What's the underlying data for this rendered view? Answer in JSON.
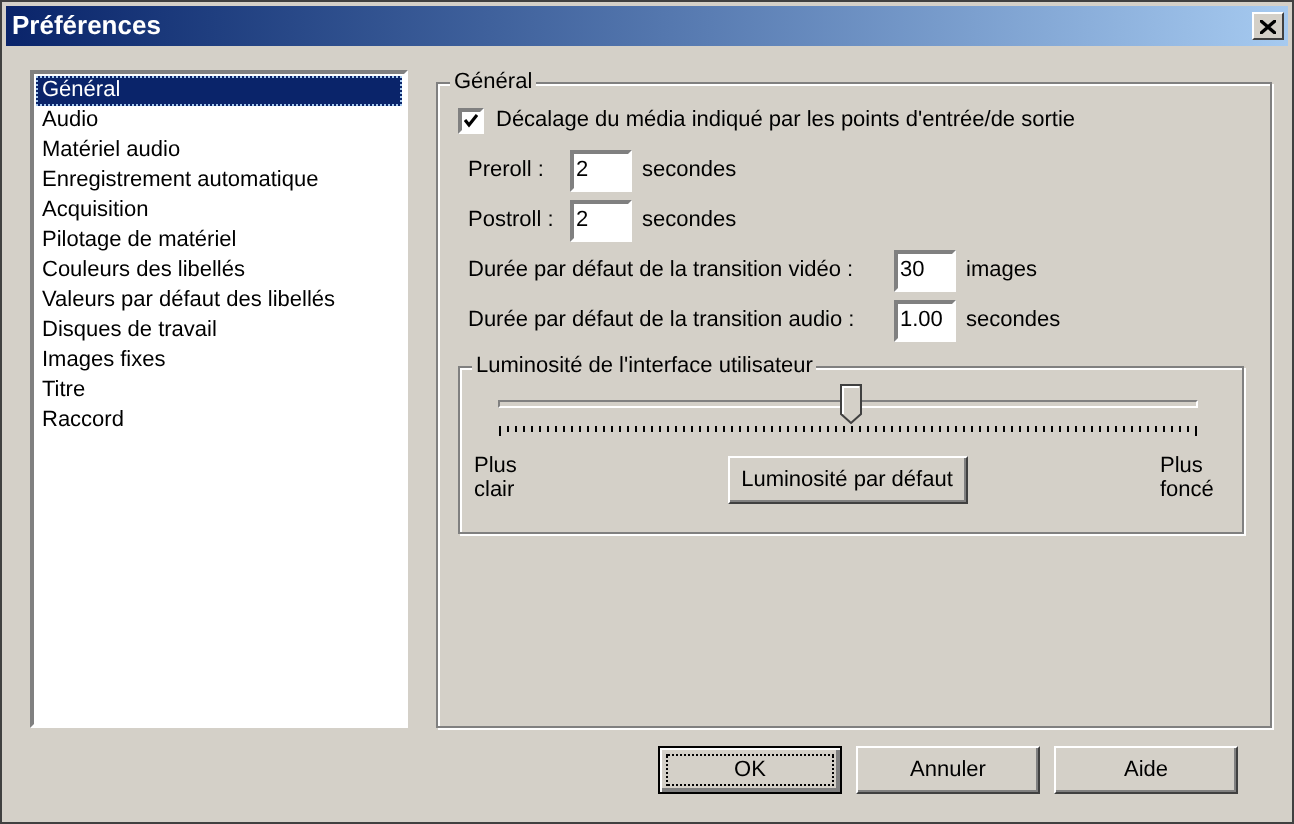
{
  "window": {
    "title": "Préférences"
  },
  "categories": [
    {
      "label": "Général",
      "selected": true
    },
    {
      "label": "Audio",
      "selected": false
    },
    {
      "label": "Matériel audio",
      "selected": false
    },
    {
      "label": "Enregistrement automatique",
      "selected": false
    },
    {
      "label": "Acquisition",
      "selected": false
    },
    {
      "label": "Pilotage de matériel",
      "selected": false
    },
    {
      "label": "Couleurs des libellés",
      "selected": false
    },
    {
      "label": "Valeurs par défaut des libellés",
      "selected": false
    },
    {
      "label": "Disques de travail",
      "selected": false
    },
    {
      "label": "Images fixes",
      "selected": false
    },
    {
      "label": "Titre",
      "selected": false
    },
    {
      "label": "Raccord",
      "selected": false
    }
  ],
  "general": {
    "title": "Général",
    "offset_checkbox": {
      "label": "Décalage du média indiqué par les points d'entrée/de sortie",
      "checked": true
    },
    "fields": [
      {
        "kind": "short",
        "label": "Preroll :",
        "value": "2",
        "unit": "secondes"
      },
      {
        "kind": "short",
        "label": "Postroll :",
        "value": "2",
        "unit": "secondes"
      },
      {
        "kind": "long",
        "label": "Durée par défaut de la transition vidéo :",
        "value": "30",
        "unit": "images"
      },
      {
        "kind": "long",
        "label": "Durée par défaut de la transition audio :",
        "value": "1.00",
        "unit": "secondes"
      }
    ],
    "brightness": {
      "title": "Luminosité de l'interface utilisateur",
      "level": 0.5,
      "min_label": "Plus clair",
      "max_label": "Plus foncé",
      "reset_button": "Luminosité par défaut"
    }
  },
  "buttons": [
    {
      "label": "OK",
      "default": true
    },
    {
      "label": "Annuler",
      "default": false
    },
    {
      "label": "Aide",
      "default": false
    }
  ]
}
